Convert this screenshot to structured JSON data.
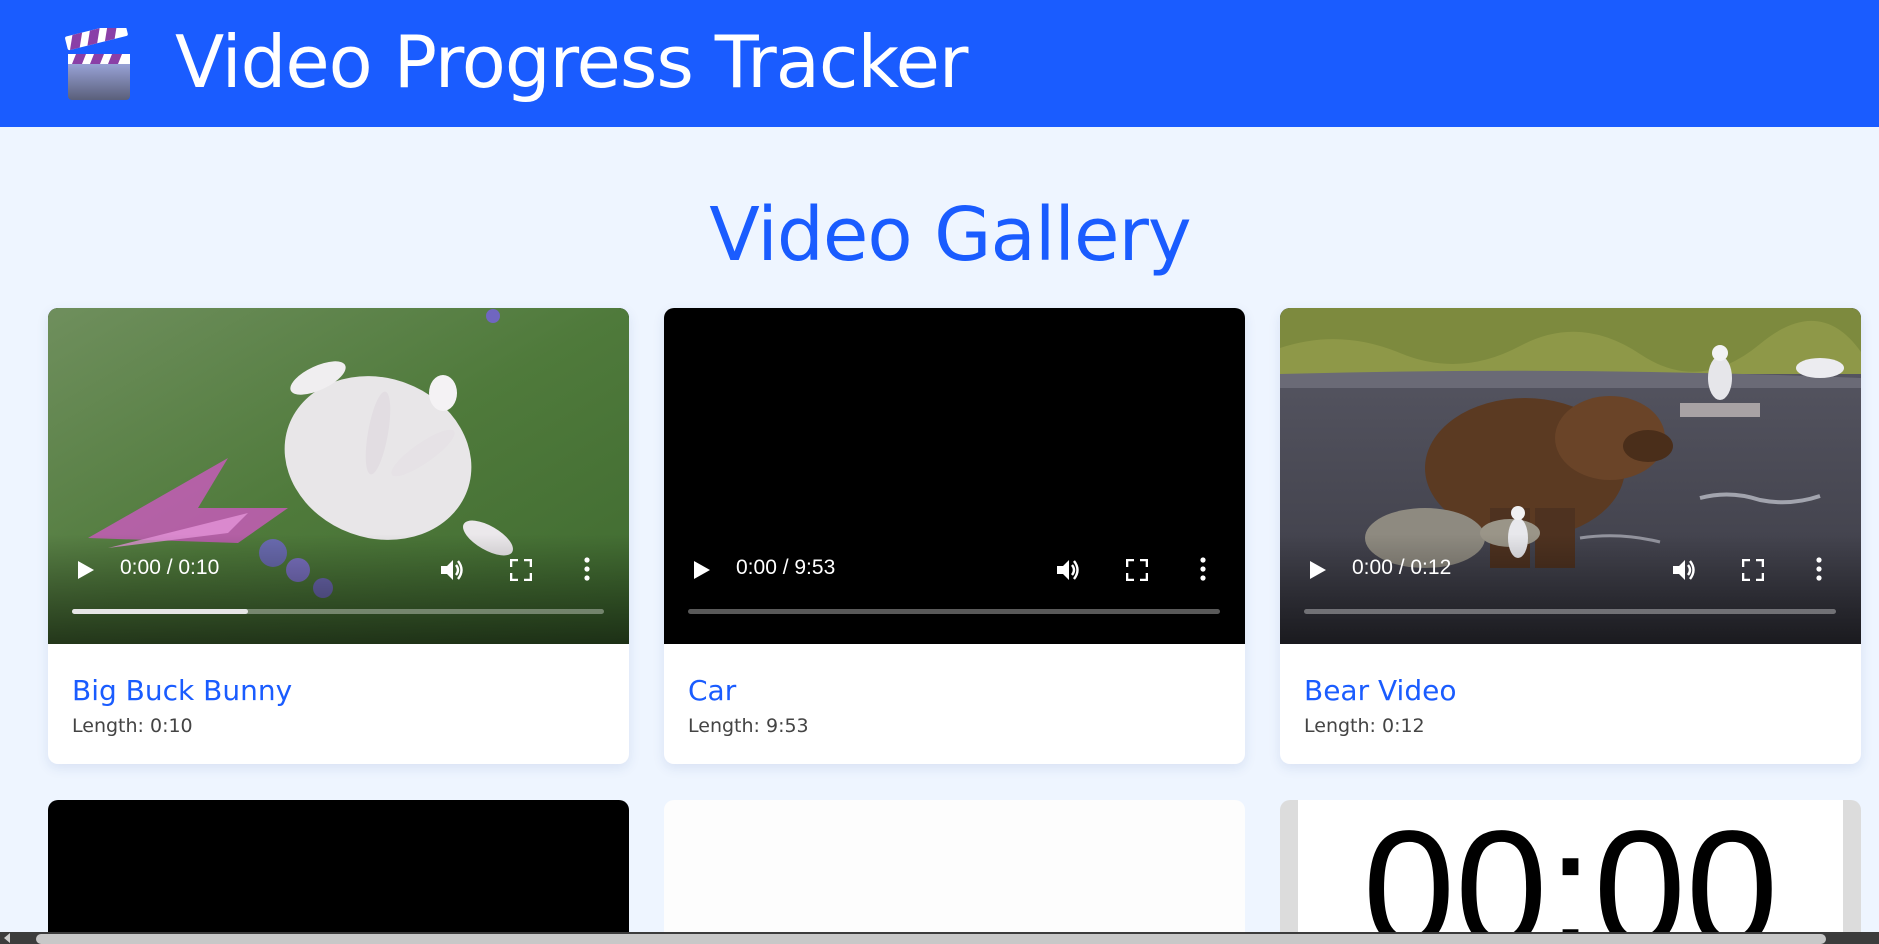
{
  "header": {
    "title": "Video Progress Tracker",
    "logo_icon": "clapperboard-icon",
    "background": "#1a5cff"
  },
  "gallery": {
    "title": "Video Gallery",
    "videos": [
      {
        "title": "Big Buck Bunny",
        "length_label": "Length: 0:10",
        "time_display": "0:00 / 0:10",
        "progress_fraction": 0.33
      },
      {
        "title": "Car",
        "length_label": "Length: 9:53",
        "time_display": "0:00 / 9:53",
        "progress_fraction": 0.0
      },
      {
        "title": "Bear Video",
        "length_label": "Length: 0:12",
        "time_display": "0:00 / 0:12",
        "progress_fraction": 0.0
      }
    ],
    "partial_row": [
      {
        "kind": "black-video"
      },
      {
        "kind": "blank-video"
      },
      {
        "kind": "timer-video",
        "display_text": "00:00"
      }
    ]
  },
  "controls": {
    "play_icon": "play-icon",
    "volume_icon": "volume-icon",
    "fullscreen_icon": "fullscreen-icon",
    "more_icon": "more-options-icon"
  },
  "colors": {
    "accent": "#1a5cff",
    "page_background": "#eef5ff"
  }
}
